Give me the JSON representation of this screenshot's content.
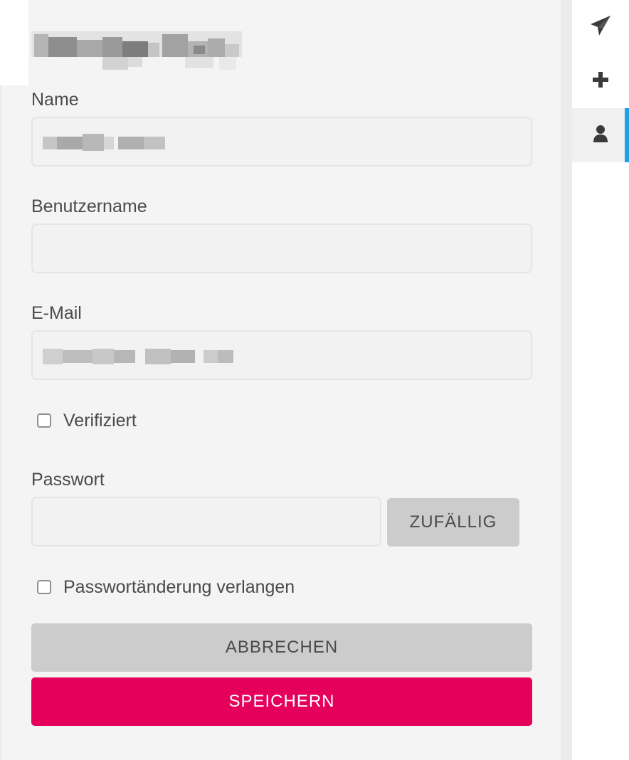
{
  "form": {
    "name_label": "Name",
    "username_label": "Benutzername",
    "username_value": "",
    "email_label": "E-Mail",
    "verified_label": "Verifiziert",
    "verified_checked": false,
    "password_label": "Passwort",
    "password_value": "",
    "random_button": "ZUFÄLLIG",
    "require_change_label": "Passwortänderung verlangen",
    "require_change_checked": false,
    "cancel_button": "ABBRECHEN",
    "save_button": "SPEICHERN"
  },
  "sidenav": {
    "items": [
      {
        "icon": "paper-plane-icon"
      },
      {
        "icon": "plus-icon"
      },
      {
        "icon": "user-icon",
        "active": true
      }
    ]
  },
  "colors": {
    "accent": "#e5005b",
    "active_indicator": "#1aa3e8",
    "panel_bg": "#f4f4f4",
    "button_grey": "#cccccc"
  }
}
